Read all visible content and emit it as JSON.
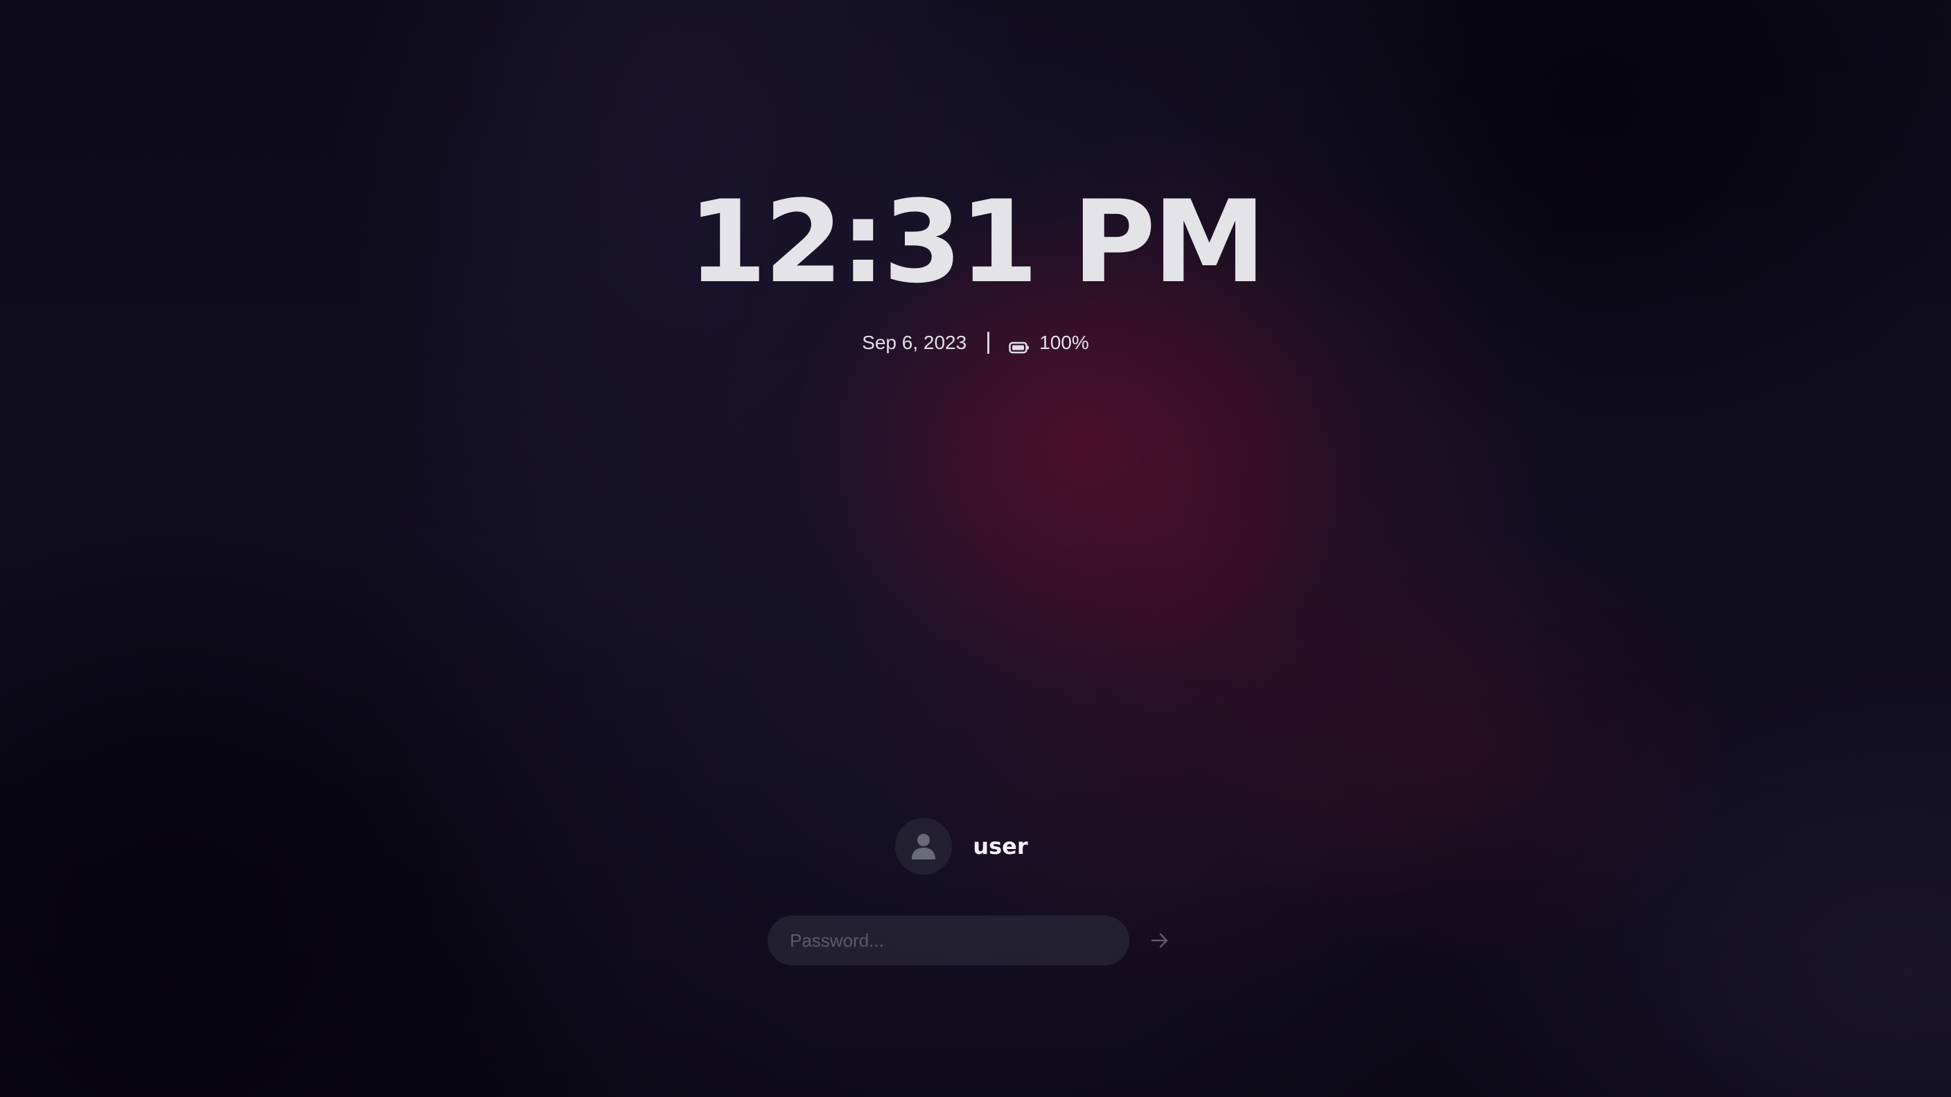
{
  "lock_screen": {
    "time": "12:31 PM",
    "date": "Sep 6, 2023",
    "battery": {
      "percent_label": "100%",
      "level": 1.0,
      "icon": "battery-icon"
    },
    "user": {
      "name": "user",
      "avatar_icon": "person-icon"
    },
    "password": {
      "value": "",
      "placeholder": "Password..."
    },
    "submit_icon": "arrow-right-icon"
  },
  "colors": {
    "text_primary": "#e4e4e8",
    "accent_glow": "#62102c",
    "background": "#0c0a18",
    "input_background": "#282536",
    "avatar_background": "#232131",
    "muted_icon": "#5c5a6a"
  }
}
